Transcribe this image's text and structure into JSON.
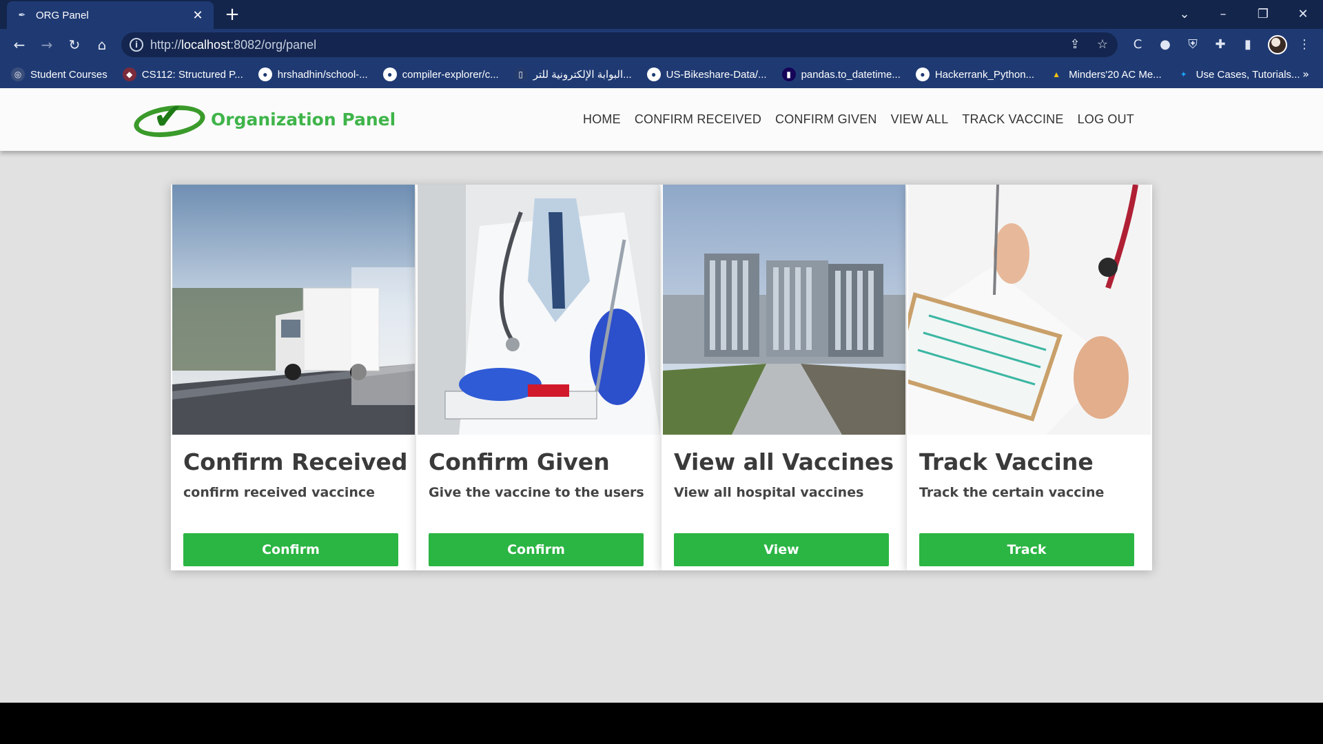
{
  "browser": {
    "tab_title": "ORG Panel",
    "new_tab": "+",
    "close": "✕",
    "url_prefix": "http://",
    "url_host": "localhost",
    "url_path": ":8082/org/panel",
    "bookmarks": [
      {
        "label": "Student Courses",
        "icon": "globe-icon"
      },
      {
        "label": "CS112: Structured P...",
        "icon": "bookmark-icon"
      },
      {
        "label": "hrshadhin/school-...",
        "icon": "github-icon"
      },
      {
        "label": "compiler-explorer/c...",
        "icon": "github-icon"
      },
      {
        "label": "البوابة الإلكترونية للتر...",
        "icon": "portal-icon"
      },
      {
        "label": "US-Bikeshare-Data/...",
        "icon": "github-icon"
      },
      {
        "label": "pandas.to_datetime...",
        "icon": "pandas-icon"
      },
      {
        "label": "Hackerrank_Python...",
        "icon": "github-icon"
      },
      {
        "label": "Minders'20 AC Me...",
        "icon": "drive-icon"
      },
      {
        "label": "Use Cases, Tutorials...",
        "icon": "twitter-icon"
      }
    ],
    "bookmarks_more": "»"
  },
  "site": {
    "brand_title": "Organization Panel",
    "menu": [
      "HOME",
      "CONFIRM RECEIVED",
      "CONFIRM GIVEN",
      "VIEW ALL",
      "TRACK VACCINE",
      "LOG OUT"
    ]
  },
  "cards": [
    {
      "title": "Confirm Received",
      "desc": "confirm received vaccince",
      "button": "Confirm",
      "image": "delivery-truck"
    },
    {
      "title": "Confirm Given",
      "desc": "Give the vaccine to the users",
      "button": "Confirm",
      "image": "doctor-with-stethoscope"
    },
    {
      "title": "View all Vaccines",
      "desc": "View all hospital vaccines",
      "button": "View",
      "image": "hospital-building"
    },
    {
      "title": "Track Vaccine",
      "desc": "Track the certain vaccine",
      "button": "Track",
      "image": "doctor-with-clipboard"
    }
  ],
  "colors": {
    "button_green": "#2bb543",
    "brand_green": "#3fb44a",
    "browser_frame": "#1f3a73"
  }
}
